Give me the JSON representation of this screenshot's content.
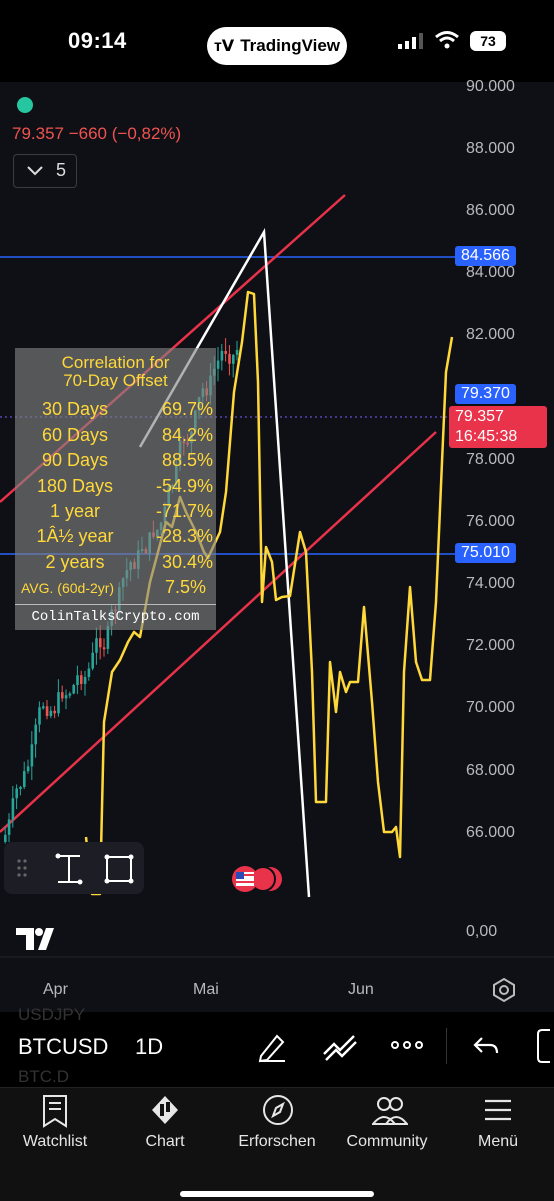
{
  "status": {
    "time": "09:14",
    "app_pill": "TradingView",
    "battery": "73"
  },
  "chart": {
    "price_line": "79.357  −660 (−0,82%)",
    "interval_chip": "5",
    "y_axis_labels": [
      "90.000",
      "88.000",
      "86.000",
      "84.000",
      "82.000",
      "78.000",
      "76.000",
      "74.000",
      "72.000",
      "70.000",
      "68.000",
      "66.000",
      "0,00"
    ],
    "price_tags": {
      "tag_84566": "84.566",
      "tag_79370": "79.370",
      "tag_79357": "79.357",
      "countdown": "16:45:38",
      "tag_75010": "75.010"
    },
    "x_axis_labels": [
      "Apr",
      "Mai",
      "Jun"
    ],
    "colors": {
      "up": "#26a69a",
      "down": "#ef5350",
      "overlay_line": "#ffd83a",
      "channel": "#e8324a",
      "hline": "#2962ff",
      "projection": "#ffffff",
      "background": "#0f1016"
    }
  },
  "correlation": {
    "title_line1": "Correlation for",
    "title_line2": "70-Day Offset",
    "rows": [
      {
        "k": "30 Days",
        "v": "69.7%"
      },
      {
        "k": "60 Days",
        "v": "84.2%"
      },
      {
        "k": "90 Days",
        "v": "88.5%"
      },
      {
        "k": "180 Days",
        "v": "-54.9%"
      },
      {
        "k": "1 year",
        "v": "-71.7%"
      },
      {
        "k": "1Â½ year",
        "v": "-28.3%"
      },
      {
        "k": "2 years",
        "v": "30.4%"
      }
    ],
    "avg_label": "AVG. (60d-2yr)",
    "avg_value": "7.5%",
    "credit": "ColinTalksCrypto.com"
  },
  "toolbar": {
    "ghost_above": "USDJPY",
    "symbol": "BTCUSD",
    "interval": "1D",
    "ghost_below": "BTC.D"
  },
  "tabs": [
    {
      "label": "Watchlist",
      "icon": "watchlist-icon"
    },
    {
      "label": "Chart",
      "icon": "chart-icon"
    },
    {
      "label": "Erforschen",
      "icon": "compass-icon"
    },
    {
      "label": "Community",
      "icon": "community-icon"
    },
    {
      "label": "Menü",
      "icon": "menu-icon"
    }
  ]
}
